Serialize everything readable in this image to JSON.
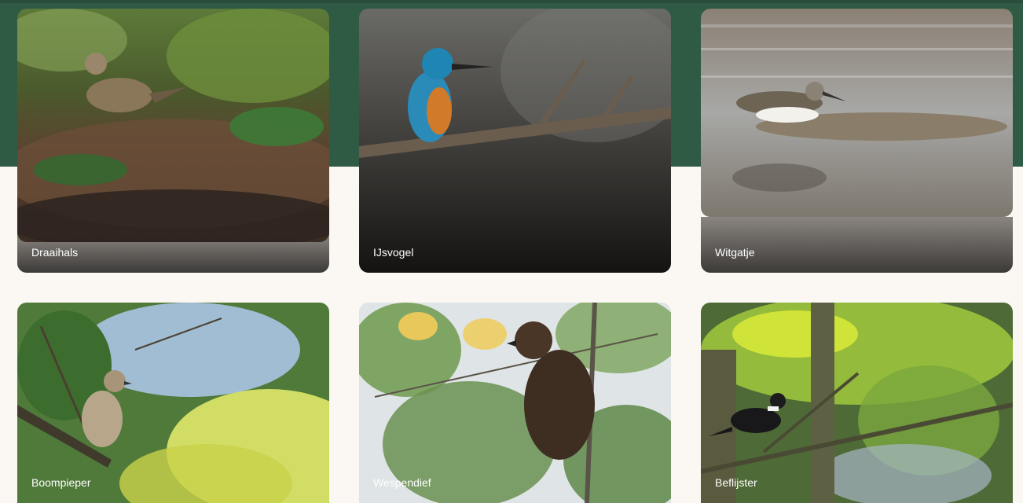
{
  "colors": {
    "band": "#2f5a44",
    "page_bg": "#fbf7f2",
    "label_text": "#ffffff"
  },
  "birds": [
    {
      "name": "Draaihals",
      "image": "wryneck-photo"
    },
    {
      "name": "IJsvogel",
      "image": "kingfisher-photo"
    },
    {
      "name": "Witgatje",
      "image": "green-sandpiper-photo"
    },
    {
      "name": "Boompieper",
      "image": "tree-pipit-photo"
    },
    {
      "name": "Wespendief",
      "image": "honey-buzzard-photo"
    },
    {
      "name": "Beflijster",
      "image": "ring-ouzel-photo"
    }
  ]
}
